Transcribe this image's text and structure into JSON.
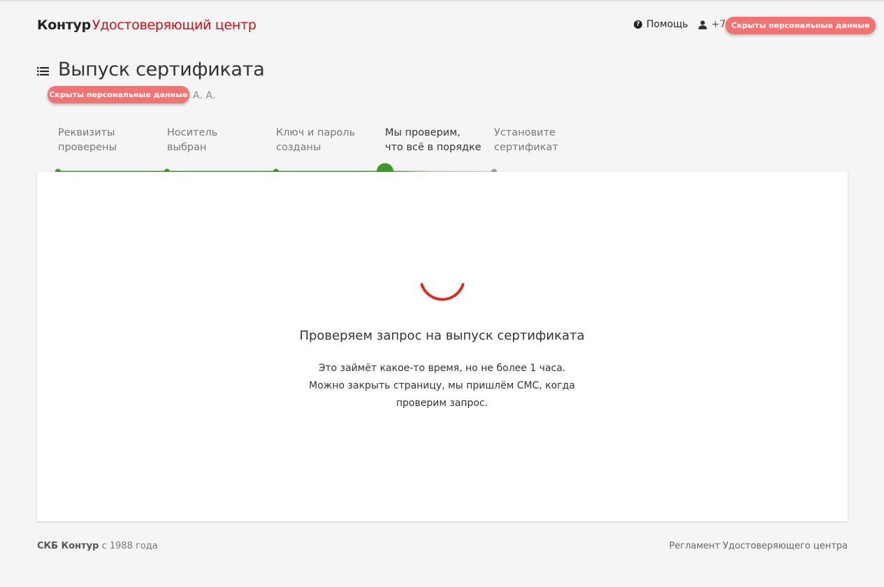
{
  "header": {
    "brand": "Контур",
    "product": "Удостоверяющий центр",
    "help_label": "Помощь",
    "phone_prefix": "+7",
    "redacted_label": "Скрыты персональные данные"
  },
  "title": {
    "text": "Выпуск сертификата",
    "redacted_label": "Скрыты персональные данные",
    "initials": "А. А."
  },
  "steps": [
    {
      "label": "Реквизиты\nпроверены",
      "state": "done"
    },
    {
      "label": "Носитель\nвыбран",
      "state": "done"
    },
    {
      "label": "Ключ и пароль\nсозданы",
      "state": "done"
    },
    {
      "label": "Мы проверим,\nчто всё в порядке",
      "state": "current"
    },
    {
      "label": "Установите\nсертификат",
      "state": "pending"
    }
  ],
  "status": {
    "title": "Проверяем запрос на выпуск сертификата",
    "line1": "Это займёт какое-то время, но не более 1 часа.",
    "line2": "Можно закрыть страницу, мы пришлём СМС, когда",
    "line3": "проверим запрос."
  },
  "footer": {
    "company": "СКБ Контур",
    "since": "с 1988 года",
    "regulation_link": "Регламент Удостоверяющего центра"
  },
  "colors": {
    "accent_red": "#d70c17",
    "progress_green": "#3d9a2a",
    "pending_gray": "#a3a3a3",
    "redaction_pink": "#f47272"
  },
  "icons": {
    "help": "help-circle-icon",
    "user": "user-icon",
    "menu": "list-menu-icon",
    "spinner": "loading-spinner-icon"
  }
}
